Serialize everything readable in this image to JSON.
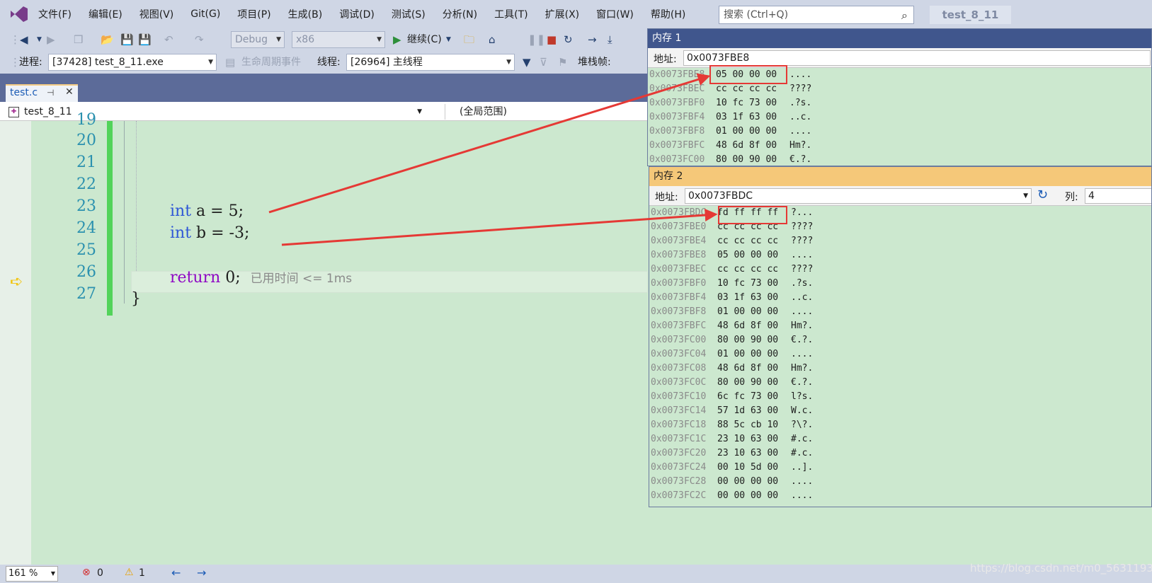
{
  "menu": [
    "文件(F)",
    "编辑(E)",
    "视图(V)",
    "Git(G)",
    "项目(P)",
    "生成(B)",
    "调试(D)",
    "测试(S)",
    "分析(N)",
    "工具(T)",
    "扩展(X)",
    "窗口(W)",
    "帮助(H)"
  ],
  "search_placeholder": "搜索 (Ctrl+Q)",
  "project_name": "test_8_11",
  "toolbar": {
    "config": "Debug",
    "platform": "x86",
    "continue": "继续(C)"
  },
  "debugbar": {
    "process_label": "进程:",
    "process": "[37428] test_8_11.exe",
    "lifecycle": "生命周期事件",
    "thread_label": "线程:",
    "thread": "[26964] 主线程",
    "stack_label": "堆栈帧:"
  },
  "tab": {
    "name": "test.c",
    "pin": "⊣",
    "close": "✕"
  },
  "nav": {
    "scope": "test_8_11",
    "global": "(全局范围)"
  },
  "code": {
    "lines": [
      "19",
      "20",
      "21",
      "22",
      "23",
      "24",
      "25",
      "26",
      "27"
    ],
    "l23_kw": "int",
    "l23_rest": " a = 5;",
    "l24_kw": "int",
    "l24_rest": " b = -3;",
    "l26_kw": "return",
    "l26_rest": " 0;",
    "l26_perf": "已用时间 <= 1ms",
    "l27": "}"
  },
  "status": {
    "zoom": "161 %",
    "errors": "0",
    "warnings": "1"
  },
  "mem1": {
    "title": "内存 1",
    "addr_label": "地址:",
    "addr": "0x0073FBE8",
    "rows": [
      {
        "a": "0x0073FBE8",
        "b": "05 00 00 00",
        "c": "...."
      },
      {
        "a": "0x0073FBEC",
        "b": "cc cc cc cc",
        "c": "????"
      },
      {
        "a": "0x0073FBF0",
        "b": "10 fc 73 00",
        "c": ".?s."
      },
      {
        "a": "0x0073FBF4",
        "b": "03 1f 63 00",
        "c": "..c."
      },
      {
        "a": "0x0073FBF8",
        "b": "01 00 00 00",
        "c": "...."
      },
      {
        "a": "0x0073FBFC",
        "b": "48 6d 8f 00",
        "c": "Hm?."
      },
      {
        "a": "0x0073FC00",
        "b": "80 00 90 00",
        "c": "€.?."
      }
    ]
  },
  "mem2": {
    "title": "内存 2",
    "addr_label": "地址:",
    "addr": "0x0073FBDC",
    "col_label": "列:",
    "col": "4",
    "rows": [
      {
        "a": "0x0073FBDC",
        "b": "fd ff ff ff",
        "c": "?..."
      },
      {
        "a": "0x0073FBE0",
        "b": "cc cc cc cc",
        "c": "????"
      },
      {
        "a": "0x0073FBE4",
        "b": "cc cc cc cc",
        "c": "????"
      },
      {
        "a": "0x0073FBE8",
        "b": "05 00 00 00",
        "c": "...."
      },
      {
        "a": "0x0073FBEC",
        "b": "cc cc cc cc",
        "c": "????"
      },
      {
        "a": "0x0073FBF0",
        "b": "10 fc 73 00",
        "c": ".?s."
      },
      {
        "a": "0x0073FBF4",
        "b": "03 1f 63 00",
        "c": "..c."
      },
      {
        "a": "0x0073FBF8",
        "b": "01 00 00 00",
        "c": "...."
      },
      {
        "a": "0x0073FBFC",
        "b": "48 6d 8f 00",
        "c": "Hm?."
      },
      {
        "a": "0x0073FC00",
        "b": "80 00 90 00",
        "c": "€.?."
      },
      {
        "a": "0x0073FC04",
        "b": "01 00 00 00",
        "c": "...."
      },
      {
        "a": "0x0073FC08",
        "b": "48 6d 8f 00",
        "c": "Hm?."
      },
      {
        "a": "0x0073FC0C",
        "b": "80 00 90 00",
        "c": "€.?."
      },
      {
        "a": "0x0073FC10",
        "b": "6c fc 73 00",
        "c": "l?s."
      },
      {
        "a": "0x0073FC14",
        "b": "57 1d 63 00",
        "c": "W.c."
      },
      {
        "a": "0x0073FC18",
        "b": "88 5c cb 10",
        "c": "?\\?."
      },
      {
        "a": "0x0073FC1C",
        "b": "23 10 63 00",
        "c": "#.c."
      },
      {
        "a": "0x0073FC20",
        "b": "23 10 63 00",
        "c": "#.c."
      },
      {
        "a": "0x0073FC24",
        "b": "00 10 5d 00",
        "c": "..]."
      },
      {
        "a": "0x0073FC28",
        "b": "00 00 00 00",
        "c": "...."
      },
      {
        "a": "0x0073FC2C",
        "b": "00 00 00 00",
        "c": "...."
      }
    ]
  },
  "annotation_color": "#e53935",
  "watermark": "https://blog.csdn.net/m0_56311933"
}
